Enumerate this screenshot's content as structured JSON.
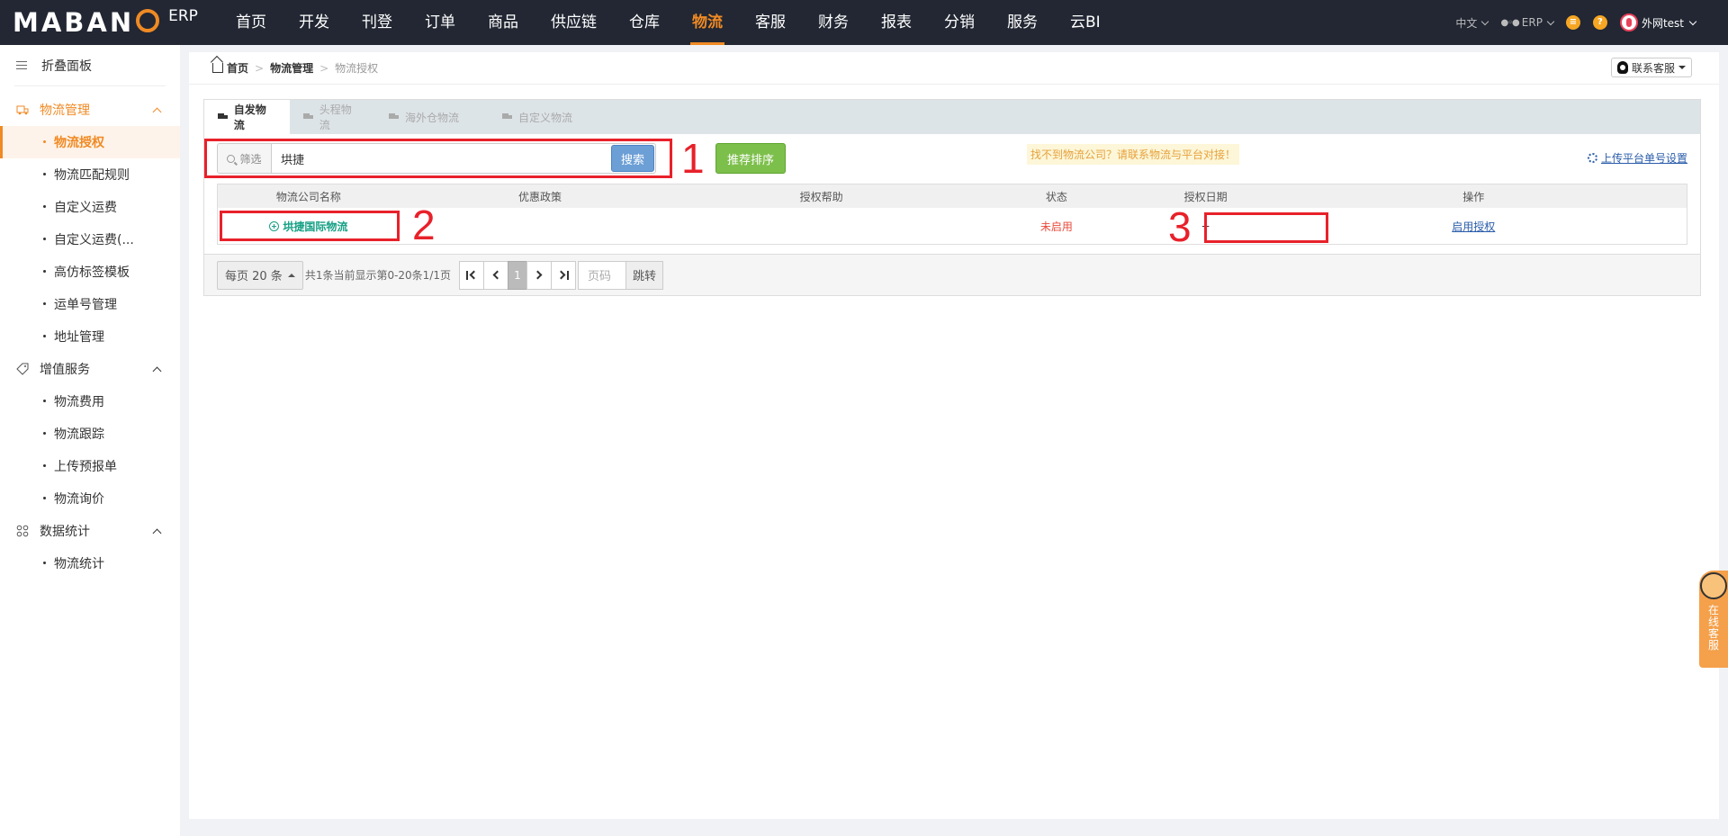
{
  "topbar": {
    "logo_text": "MABAN",
    "logo_suffix": "ERP",
    "nav": [
      "首页",
      "开发",
      "刊登",
      "订单",
      "商品",
      "供应链",
      "仓库",
      "物流",
      "客服",
      "财务",
      "报表",
      "分销",
      "服务",
      "云BI"
    ],
    "active_nav": "物流",
    "lang": "中文",
    "erp": "ERP",
    "help_icon": "?",
    "user": "外网test"
  },
  "sidebar": {
    "fold_label": "折叠面板",
    "groups": [
      {
        "label": "物流管理",
        "items": [
          "物流授权",
          "物流匹配规则",
          "自定义运费",
          "自定义运费(...",
          "高仿标签模板",
          "运单号管理",
          "地址管理"
        ]
      },
      {
        "label": "增值服务",
        "items": [
          "物流费用",
          "物流跟踪",
          "上传预报单",
          "物流询价"
        ]
      },
      {
        "label": "数据统计",
        "items": [
          "物流统计"
        ]
      }
    ],
    "active_item": "物流授权"
  },
  "breadcrumb": {
    "home": "首页",
    "section": "物流管理",
    "current": "物流授权"
  },
  "contact_button": "联系客服",
  "tabs": [
    "自发物流",
    "头程物流",
    "海外仓物流",
    "自定义物流"
  ],
  "filter": {
    "label": "筛选",
    "value": "垬捷",
    "search_button": "搜索",
    "recommend_button": "推荐排序",
    "notice": "找不到物流公司？请联系物流与平台对接！",
    "upload_link": "上传平台单号设置"
  },
  "annotations": [
    "1",
    "2",
    "3"
  ],
  "table": {
    "headers": [
      "物流公司名称",
      "优惠政策",
      "授权帮助",
      "状态",
      "授权日期",
      "操作"
    ],
    "rows": [
      {
        "company": "垬捷国际物流",
        "policy": "",
        "help": "",
        "status": "未启用",
        "date": "--",
        "action": "启用授权"
      }
    ]
  },
  "pager": {
    "per_page": "每页 20 条",
    "info": "共1条当前显示第0-20条1/1页",
    "current_page": "1",
    "page_placeholder": "页码",
    "jump": "跳转"
  },
  "float_service": "在线客服",
  "colors": {
    "brand": "#f08a24",
    "topbar": "#222733",
    "annotation_red": "#e8212a"
  }
}
